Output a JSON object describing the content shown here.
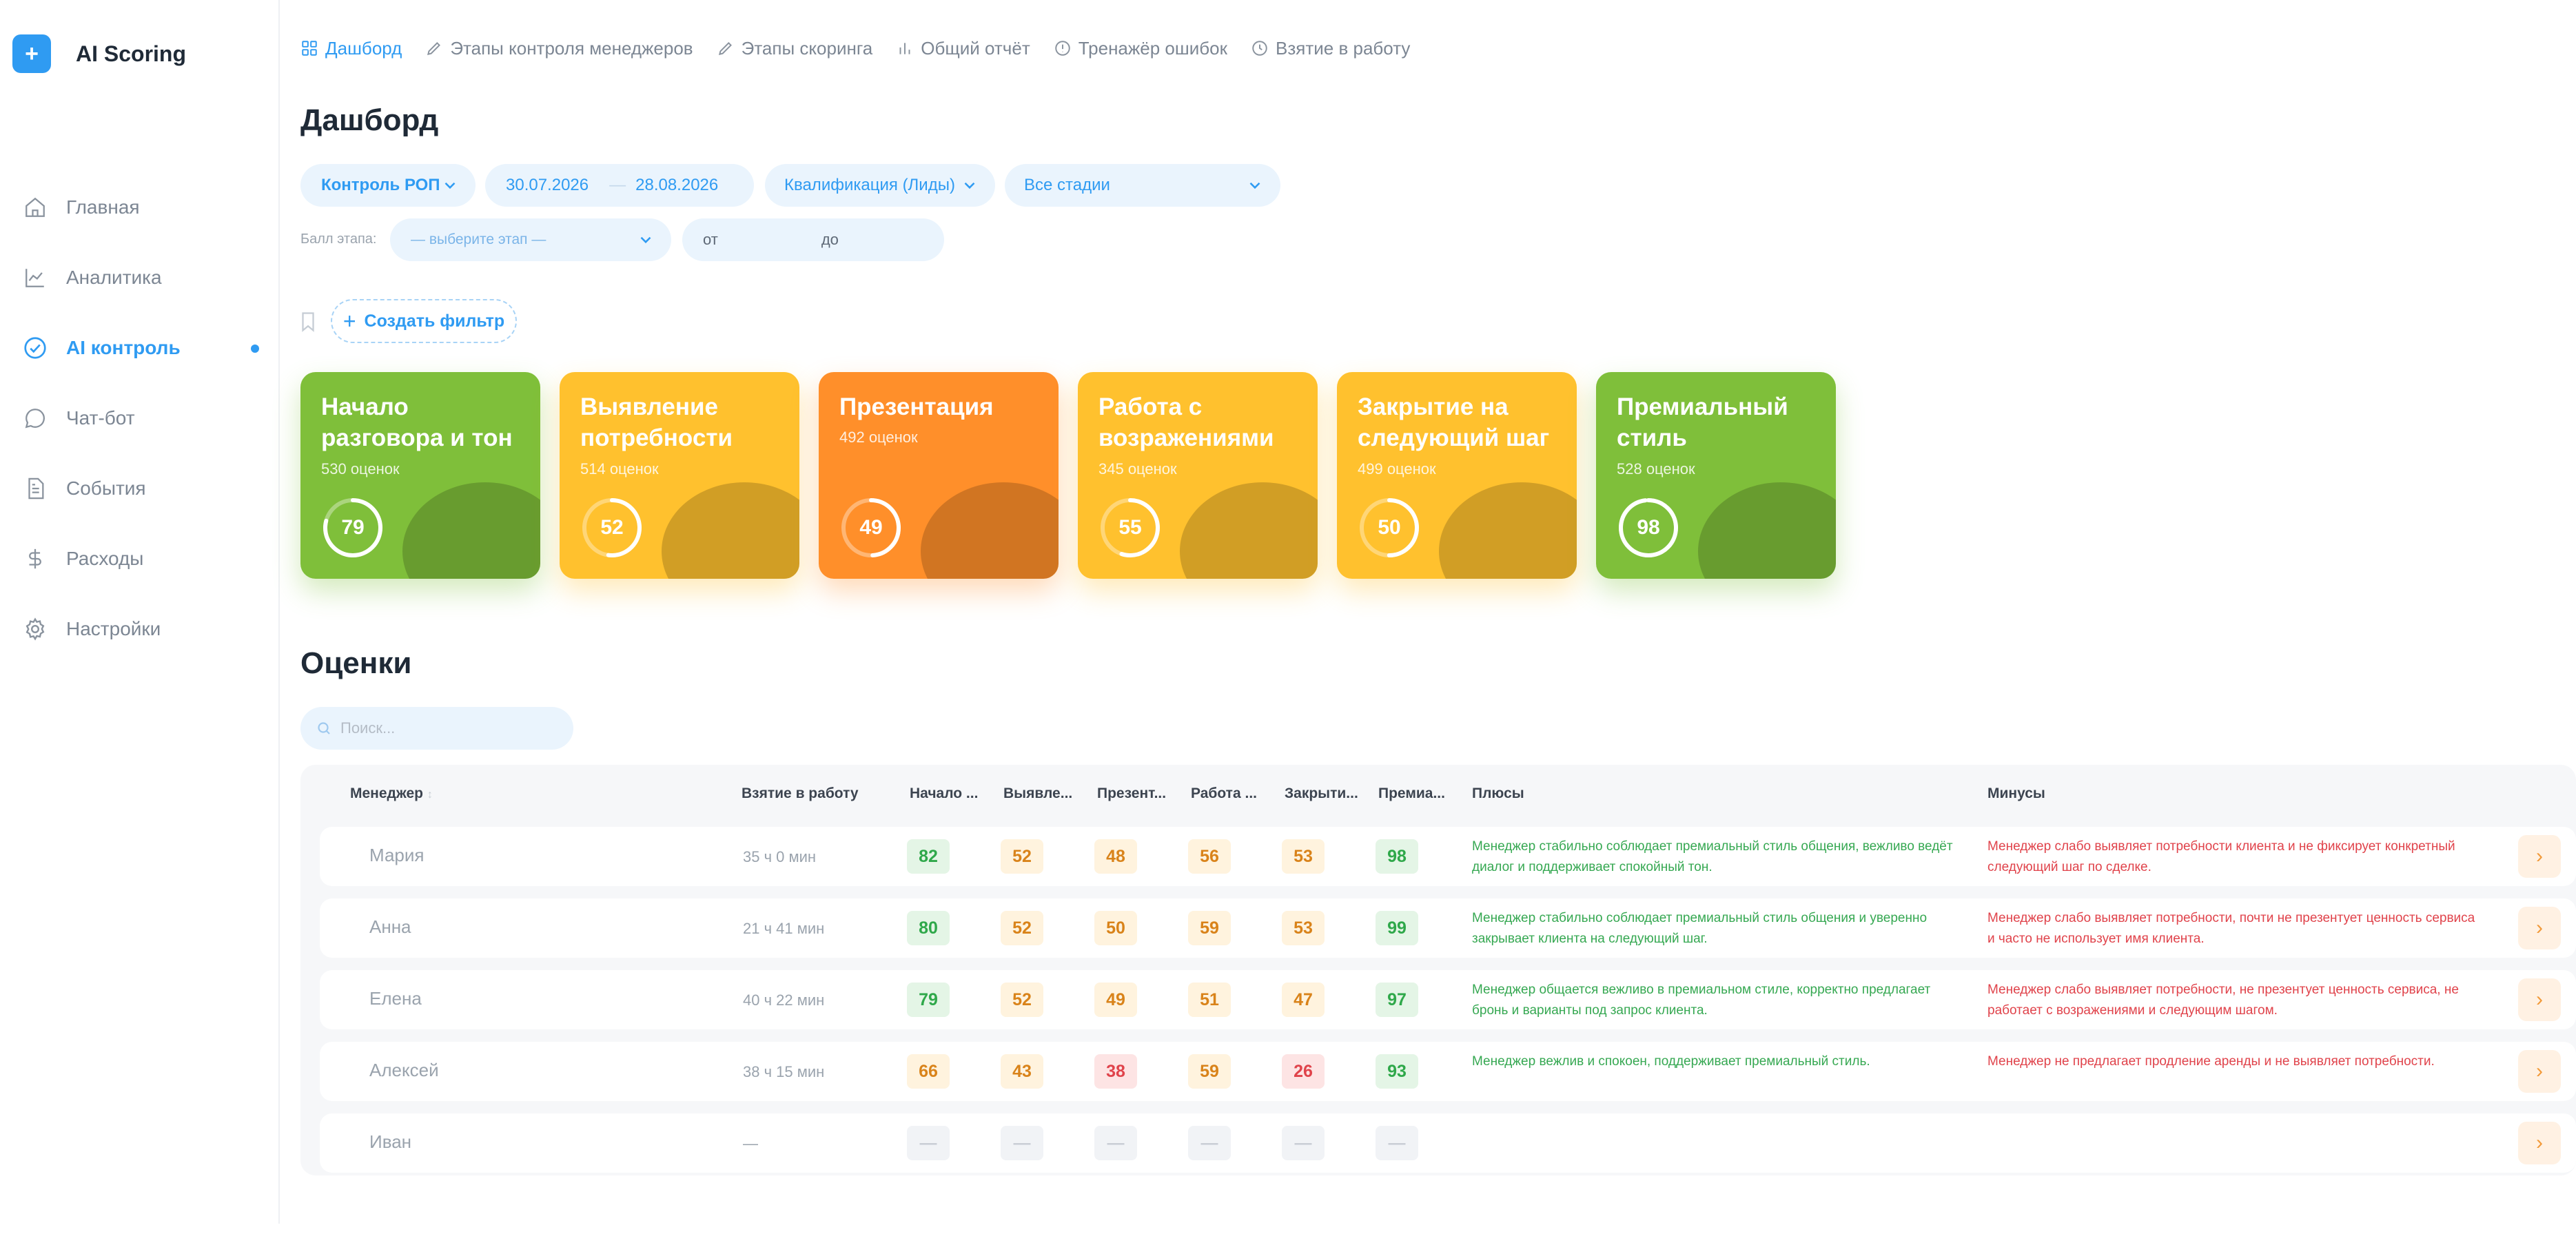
{
  "app": {
    "logo_mark": "+",
    "title": "AI Scoring"
  },
  "sidebar": {
    "items": [
      {
        "label": "Главная",
        "icon": "home-icon"
      },
      {
        "label": "Аналитика",
        "icon": "chart-line-icon"
      },
      {
        "label": "AI контроль",
        "icon": "check-circle-icon",
        "active": true
      },
      {
        "label": "Чат-бот",
        "icon": "chat-icon"
      },
      {
        "label": "События",
        "icon": "document-icon"
      },
      {
        "label": "Расходы",
        "icon": "dollar-icon"
      },
      {
        "label": "Настройки",
        "icon": "gear-icon"
      }
    ]
  },
  "topnav": {
    "tabs": [
      {
        "label": "Дашборд",
        "icon": "grid-icon"
      },
      {
        "label": "Этапы контроля менеджеров",
        "icon": "pen-icon"
      },
      {
        "label": "Этапы скоринга",
        "icon": "pen-icon"
      },
      {
        "label": "Общий отчёт",
        "icon": "bar-chart-icon"
      },
      {
        "label": "Тренажёр ошибок",
        "icon": "alert-circle-icon"
      },
      {
        "label": "Взятие в работу",
        "icon": "clock-icon"
      }
    ]
  },
  "page": {
    "title": "Дашборд"
  },
  "filters": {
    "control": "Контроль РОП",
    "date_from": "30.07.2026",
    "date_to": "28.08.2026",
    "qualification": "Квалификация (Лиды)",
    "stages": "Все стадии",
    "score_label": "Балл этапа:",
    "stage_select_placeholder": "— выберите этап —",
    "from_label": "от",
    "to_label": "до",
    "create_filter": "Создать фильтр"
  },
  "cards": [
    {
      "title": "Начало разговора и тон",
      "sub": "530 оценок",
      "score": 79,
      "color": "#7fbf3a"
    },
    {
      "title": "Выявление потребности",
      "sub": "514 оценок",
      "score": 52,
      "color": "#ffc12e"
    },
    {
      "title": "Презентация",
      "sub": "492 оценок",
      "score": 49,
      "color": "#ff8f2a"
    },
    {
      "title": "Работа с возражениями",
      "sub": "345 оценок",
      "score": 55,
      "color": "#ffc12e"
    },
    {
      "title": "Закрытие на следующий шаг",
      "sub": "499 оценок",
      "score": 50,
      "color": "#ffc12e"
    },
    {
      "title": "Премиальный стиль",
      "sub": "528 оценок",
      "score": 98,
      "color": "#7fbf3a"
    }
  ],
  "ratings": {
    "title": "Оценки",
    "search_placeholder": "Поиск...",
    "columns": [
      "Менеджер",
      "Взятие в работу",
      "Начало ...",
      "Выявле...",
      "Презент...",
      "Работа ...",
      "Закрыти...",
      "Премиа...",
      "Плюсы",
      "Минусы"
    ],
    "sort_indicator": "↕",
    "rows": [
      {
        "name": "Мария",
        "time": "35 ч 0 мин",
        "scores": [
          "82",
          "52",
          "48",
          "56",
          "53",
          "98"
        ],
        "levels": [
          "green",
          "orange",
          "orange",
          "orange",
          "orange",
          "green"
        ],
        "plus": "Менеджер стабильно соблюдает премиальный стиль общения, вежливо ведёт диалог и поддерживает спокойный тон.",
        "minus": "Менеджер слабо выявляет потребности клиента и не фиксирует конкретный следующий шаг по сделке."
      },
      {
        "name": "Анна",
        "time": "21 ч 41 мин",
        "scores": [
          "80",
          "52",
          "50",
          "59",
          "53",
          "99"
        ],
        "levels": [
          "green",
          "orange",
          "orange",
          "orange",
          "orange",
          "green"
        ],
        "plus": "Менеджер стабильно соблюдает премиальный стиль общения и уверенно закрывает клиента на следующий шаг.",
        "minus": "Менеджер слабо выявляет потребности, почти не презентует ценность сервиса и часто не использует имя клиента."
      },
      {
        "name": "Елена",
        "time": "40 ч 22 мин",
        "scores": [
          "79",
          "52",
          "49",
          "51",
          "47",
          "97"
        ],
        "levels": [
          "green",
          "orange",
          "orange",
          "orange",
          "orange",
          "green"
        ],
        "plus": "Менеджер общается вежливо в премиальном стиле, корректно предлагает бронь и варианты под запрос клиента.",
        "minus": "Менеджер слабо выявляет потребности, не презентует ценность сервиса, не работает с возражениями и следующим шагом."
      },
      {
        "name": "Алексей",
        "time": "38 ч 15 мин",
        "scores": [
          "66",
          "43",
          "38",
          "59",
          "26",
          "93"
        ],
        "levels": [
          "orange",
          "orange",
          "red",
          "orange",
          "red",
          "green"
        ],
        "plus": "Менеджер вежлив и спокоен, поддерживает премиальный стиль.",
        "minus": "Менеджер не предлагает продление аренды и не выявляет потребности."
      },
      {
        "name": "Иван",
        "time": "—",
        "scores": [
          "—",
          "—",
          "—",
          "—",
          "—",
          "—"
        ],
        "levels": [
          "empty",
          "empty",
          "empty",
          "empty",
          "empty",
          "empty"
        ],
        "plus": "",
        "minus": ""
      }
    ],
    "row_action": "›"
  }
}
